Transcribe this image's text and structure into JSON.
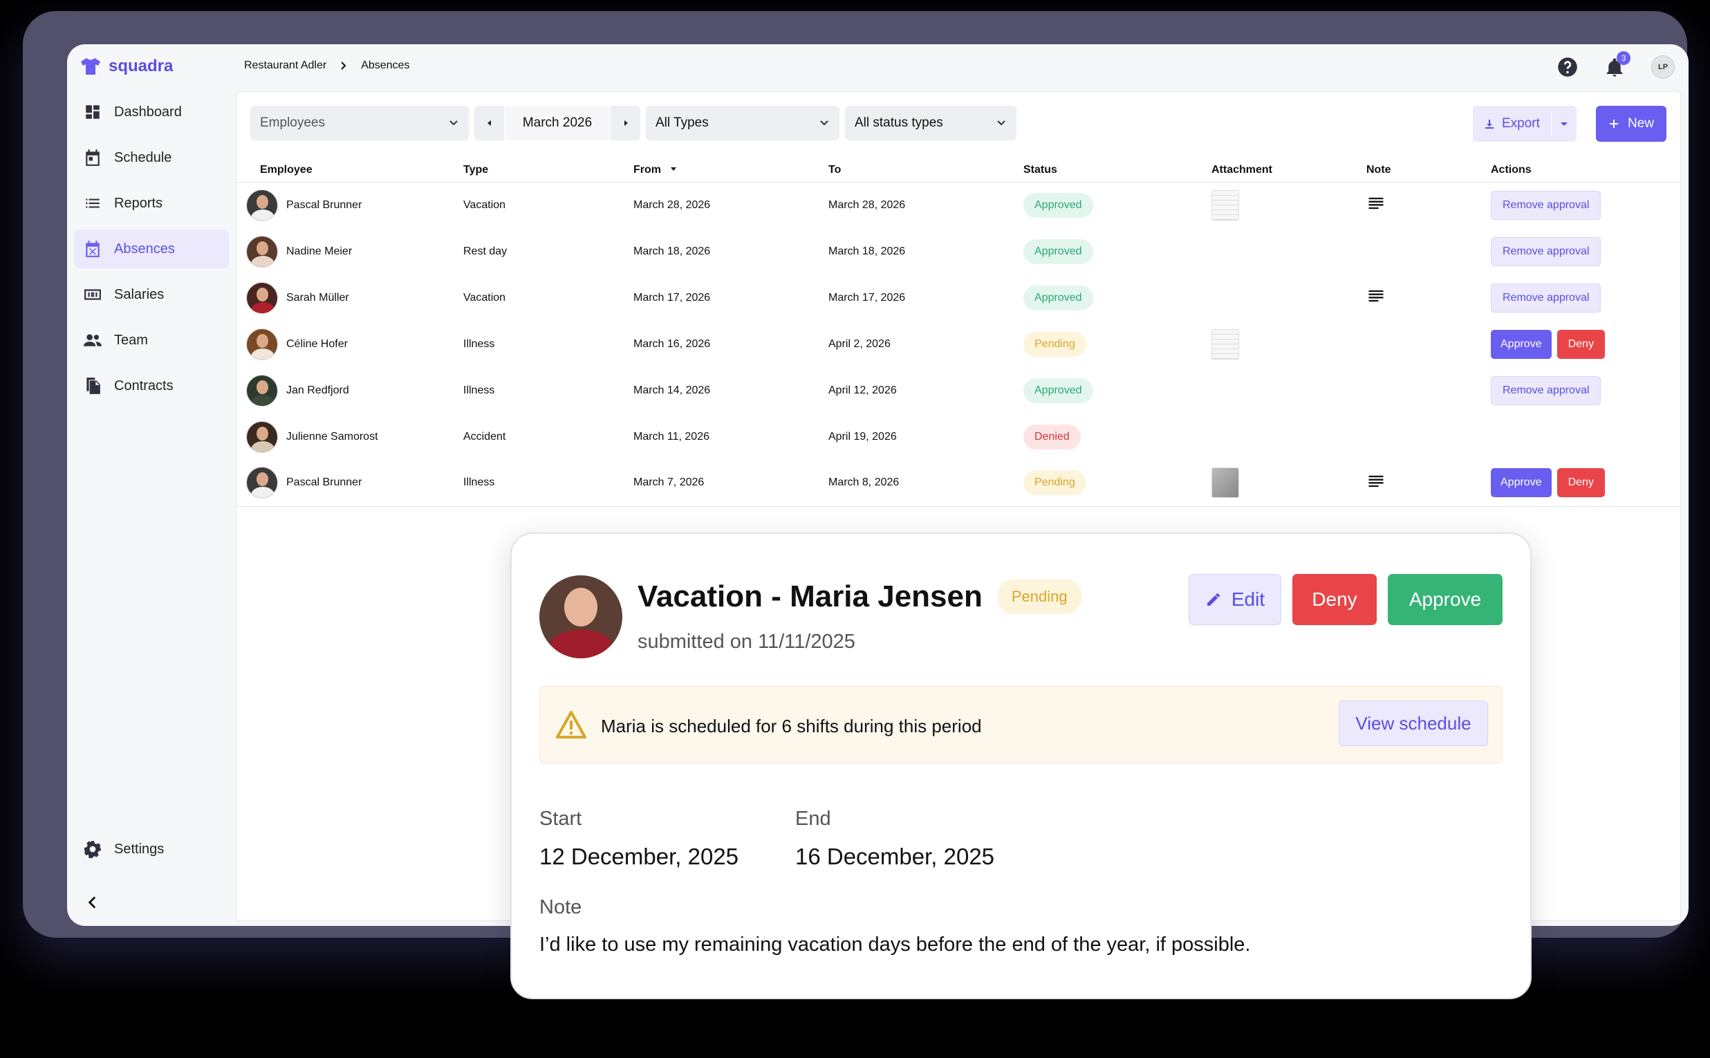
{
  "app": {
    "name": "squadra",
    "brand_color": "#6a5ef0"
  },
  "breadcrumb": [
    "Restaurant Adler",
    "Absences"
  ],
  "notifications": {
    "count": "3"
  },
  "user": {
    "initials": "LP"
  },
  "sidebar": {
    "items": [
      {
        "label": "Dashboard",
        "icon": "dashboard-icon",
        "active": false
      },
      {
        "label": "Schedule",
        "icon": "calendar-icon",
        "active": false
      },
      {
        "label": "Reports",
        "icon": "list-icon",
        "active": false
      },
      {
        "label": "Absences",
        "icon": "calendar-x-icon",
        "active": true
      },
      {
        "label": "Salaries",
        "icon": "money-icon",
        "active": false
      },
      {
        "label": "Team",
        "icon": "team-icon",
        "active": false
      },
      {
        "label": "Contracts",
        "icon": "document-icon",
        "active": false
      }
    ],
    "settings_label": "Settings"
  },
  "filters": {
    "employees_placeholder": "Employees",
    "month": "March 2026",
    "type": "All Types",
    "status": "All status types",
    "export_label": "Export",
    "new_label": "New"
  },
  "table": {
    "headers": [
      "Employee",
      "Type",
      "From",
      "To",
      "Status",
      "Attachment",
      "Note",
      "Actions"
    ],
    "rows": [
      {
        "employee": "Pascal Brunner",
        "type": "Vacation",
        "from": "March 28, 2026",
        "to": "March 28, 2026",
        "status": "Approved",
        "attachment": "document",
        "note": true,
        "actions": [
          "Remove approval"
        ]
      },
      {
        "employee": "Nadine Meier",
        "type": "Rest day",
        "from": "March 18, 2026",
        "to": "March 18, 2026",
        "status": "Approved",
        "attachment": "",
        "note": false,
        "actions": [
          "Remove approval"
        ]
      },
      {
        "employee": "Sarah Müller",
        "type": "Vacation",
        "from": "March 17, 2026",
        "to": "March 17, 2026",
        "status": "Approved",
        "attachment": "",
        "note": true,
        "actions": [
          "Remove approval"
        ]
      },
      {
        "employee": "Céline Hofer",
        "type": "Illness",
        "from": "March 16, 2026",
        "to": "April 2, 2026",
        "status": "Pending",
        "attachment": "document",
        "note": false,
        "actions": [
          "Approve",
          "Deny"
        ]
      },
      {
        "employee": "Jan Redfjord",
        "type": "Illness",
        "from": "March 14, 2026",
        "to": "April 12, 2026",
        "status": "Approved",
        "attachment": "",
        "note": false,
        "actions": [
          "Remove approval"
        ]
      },
      {
        "employee": "Julienne Samorost",
        "type": "Accident",
        "from": "March 11, 2026",
        "to": "April 19, 2026",
        "status": "Denied",
        "attachment": "",
        "note": false,
        "actions": []
      },
      {
        "employee": "Pascal Brunner",
        "type": "Illness",
        "from": "March 7, 2026",
        "to": "March 8, 2026",
        "status": "Pending",
        "attachment": "photo",
        "note": true,
        "actions": [
          "Approve",
          "Deny"
        ]
      }
    ]
  },
  "detail": {
    "title": "Vacation - Maria Jensen",
    "status": "Pending",
    "submitted": "submitted on 11/11/2025",
    "edit_label": "Edit",
    "deny_label": "Deny",
    "approve_label": "Approve",
    "warning": "Maria is scheduled for 6 shifts during this period",
    "view_schedule_label": "View schedule",
    "start_label": "Start",
    "start_value": "12 December, 2025",
    "end_label": "End",
    "end_value": "16 December, 2025",
    "note_label": "Note",
    "note_value": "I’d like to use my remaining vacation days before the end of the year, if possible."
  }
}
